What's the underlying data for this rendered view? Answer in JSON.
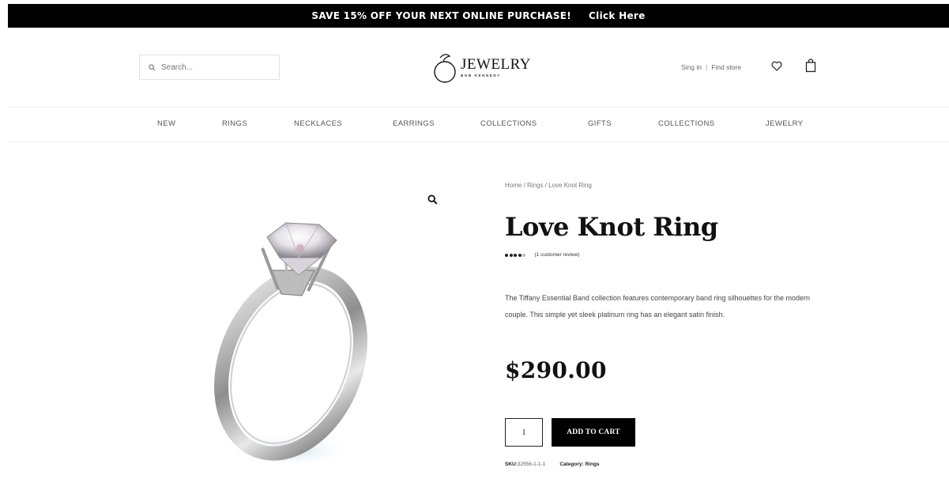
{
  "promo": {
    "text": "SAVE 15% OFF YOUR NEXT ONLINE PURCHASE!",
    "cta": "Click Here"
  },
  "header": {
    "search_placeholder": "Search...",
    "brand": "JEWELRY",
    "tagline": "BOB KENNEDY",
    "signin": "Sing in",
    "separator": "|",
    "find_store": "Find store",
    "icons": [
      "search-icon",
      "ring-logo-icon",
      "heart-icon",
      "shopping-bag-icon"
    ]
  },
  "nav": {
    "items": [
      "NEW",
      "RINGS",
      "NECKLACES",
      "EARRINGS",
      "COLLECTIONS",
      "GIFTS",
      "COLLECTIONS",
      "JEWELRY"
    ]
  },
  "product": {
    "breadcrumb": {
      "home": "Home",
      "category": "Rings",
      "current": "Love Knot Ring",
      "separator": " / "
    },
    "title": "Love Knot Ring",
    "rating": {
      "stars": 4,
      "max": 5,
      "reviews": "(1 customer review)"
    },
    "description": "The Tiffany Essential Band collection features contemporary band ring silhouettes for the modern couple. This simple yet sleek platinum ring has an elegant satin finish.",
    "price": "$290.00",
    "quantity": "1",
    "add_to_cart": "ADD TO CART",
    "sku_label": "SKU:",
    "sku_value": "32556-1-1-1",
    "category_label": "Category:",
    "category_value": "Rings"
  },
  "colors": {
    "promo_bg": "#000000",
    "button_bg": "#000000",
    "text": "#111111"
  }
}
